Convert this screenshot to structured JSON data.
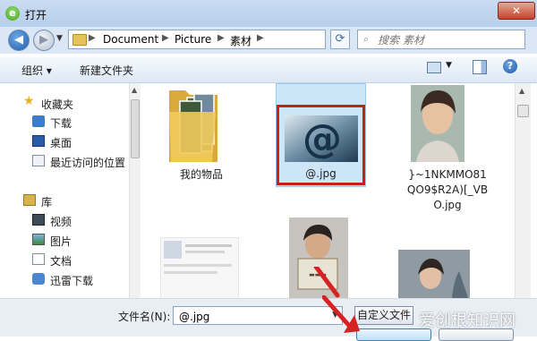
{
  "window": {
    "title": "打开",
    "close_glyph": "✕"
  },
  "address": {
    "crumbs": [
      "Document",
      "Picture",
      "素材"
    ],
    "search_placeholder": "搜索 素材"
  },
  "toolbar": {
    "organize_label": "组织 ▾",
    "new_folder_label": "新建文件夹",
    "help_glyph": "?"
  },
  "sidebar": {
    "favorites_label": "收藏夹",
    "favorites": [
      "下载",
      "桌面",
      "最近访问的位置"
    ],
    "libraries_label": "库",
    "libraries": [
      "视频",
      "图片",
      "文档",
      "迅雷下载"
    ]
  },
  "files": [
    {
      "name": "我的物品",
      "type": "folder"
    },
    {
      "name": "@.jpg",
      "type": "image",
      "selected": true,
      "highlighted": true
    },
    {
      "name": "}~1NKMMO81 QO9$R2A)[_VBO.jpg",
      "name_lines": [
        "}~1NKMMO81",
        "QO9$R2A)[_VB",
        "O.jpg"
      ],
      "type": "image"
    },
    {
      "name": "",
      "type": "image"
    },
    {
      "name": "",
      "type": "image"
    },
    {
      "name": "",
      "type": "image"
    }
  ],
  "footer": {
    "filename_label": "文件名(N):",
    "filename_value": "@.jpg",
    "filter_label": "自定义文件"
  },
  "watermark": "爱创根知识网",
  "colors": {
    "highlight_box": "#c81e1e",
    "annotation_arrow": "#d62222",
    "selection": "#cde6f7"
  }
}
